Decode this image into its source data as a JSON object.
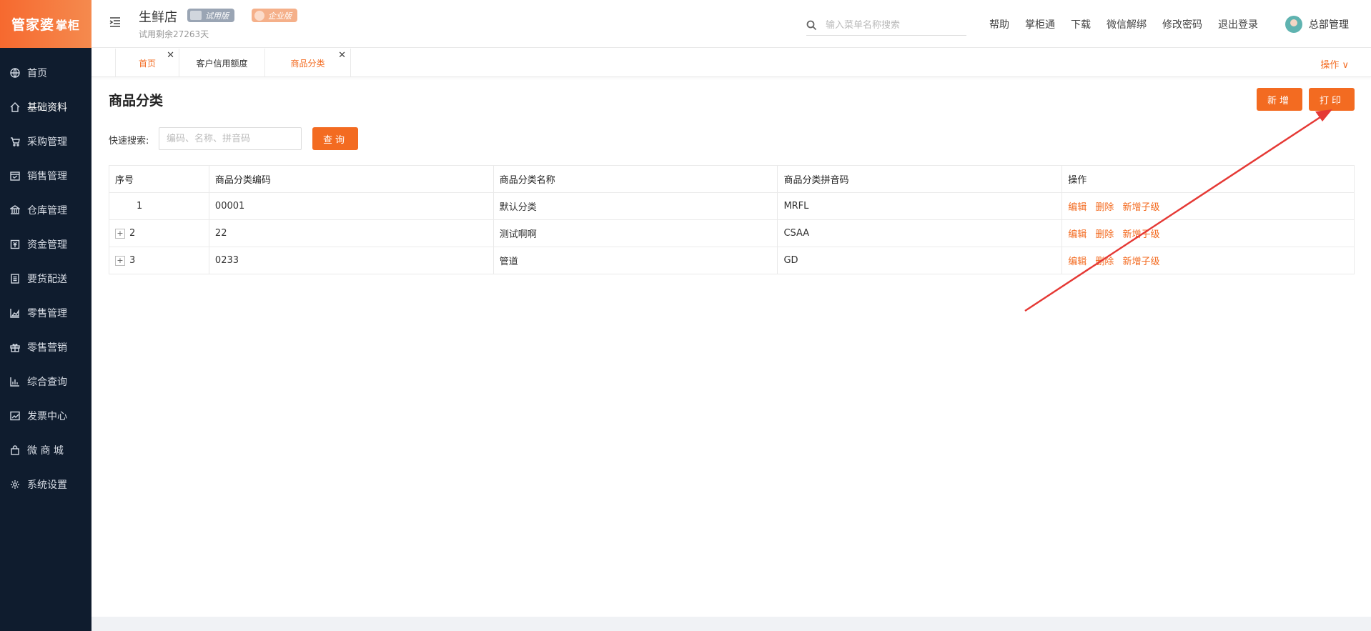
{
  "logo": {
    "main": "管家婆",
    "sub": "掌柜"
  },
  "sidebar": {
    "items": [
      {
        "label": "首页",
        "icon": "globe-icon"
      },
      {
        "label": "基础资料",
        "icon": "home-icon"
      },
      {
        "label": "采购管理",
        "icon": "cart-icon"
      },
      {
        "label": "销售管理",
        "icon": "calendar-icon"
      },
      {
        "label": "仓库管理",
        "icon": "bank-icon"
      },
      {
        "label": "资金管理",
        "icon": "money-icon"
      },
      {
        "label": "要货配送",
        "icon": "list-icon"
      },
      {
        "label": "零售管理",
        "icon": "area-chart-icon"
      },
      {
        "label": "零售营销",
        "icon": "gift-icon"
      },
      {
        "label": "综合查询",
        "icon": "bar-chart-icon"
      },
      {
        "label": "发票中心",
        "icon": "line-chart-icon"
      },
      {
        "label": "微 商 城",
        "icon": "bag-icon"
      },
      {
        "label": "系统设置",
        "icon": "gear-icon"
      }
    ]
  },
  "header": {
    "store_name": "生鲜店",
    "trial_badge": "试用版",
    "edition_badge": "企业版",
    "trial_days": "试用剩余27263天",
    "search_placeholder": "输入菜单名称搜索",
    "links": [
      "帮助",
      "掌柜通",
      "下载",
      "微信解绑",
      "修改密码",
      "退出登录"
    ],
    "user": "总部管理"
  },
  "tabs": {
    "items": [
      "首页",
      "客户信用额度",
      "商品分类"
    ],
    "ops_label": "操作 ∨"
  },
  "page": {
    "title": "商品分类",
    "add_label": "新增",
    "print_label": "打印",
    "quick_search_label": "快速搜索:",
    "quick_search_placeholder": "编码、名称、拼音码",
    "query_label": "查询"
  },
  "table": {
    "headers": [
      "序号",
      "商品分类编码",
      "商品分类名称",
      "商品分类拼音码",
      "操作"
    ],
    "rows": [
      {
        "index": "1",
        "code": "00001",
        "name": "默认分类",
        "pinyin": "MRFL",
        "expandable": false
      },
      {
        "index": "2",
        "code": "22",
        "name": "测试啊啊",
        "pinyin": "CSAA",
        "expandable": true
      },
      {
        "index": "3",
        "code": "0233",
        "name": "管道",
        "pinyin": "GD",
        "expandable": true
      }
    ],
    "row_ops": [
      "编辑",
      "删除",
      "新增子级"
    ]
  },
  "colors": {
    "accent": "#f36b21",
    "sidebar_bg": "#0f1c2e",
    "annotation_arrow": "#e53935"
  }
}
